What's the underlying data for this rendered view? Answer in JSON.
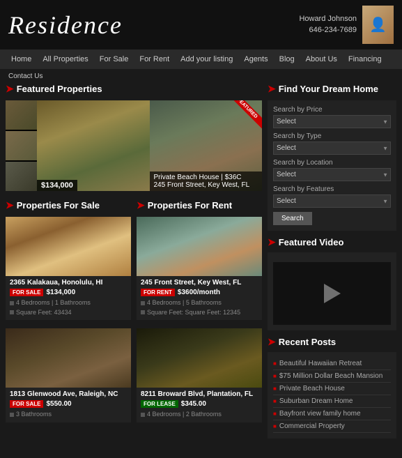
{
  "header": {
    "logo": "Residence",
    "user": {
      "name": "Howard Johnson",
      "phone": "646-234-7689"
    }
  },
  "nav": {
    "items": [
      "Home",
      "All Properties",
      "For Sale",
      "For Rent",
      "Add your listing",
      "Agents",
      "Blog",
      "About Us",
      "Financing"
    ]
  },
  "contact": {
    "label": "Contact Us"
  },
  "featured_properties": {
    "title": "Featured Properties",
    "badge": "FEATURED",
    "slide1": {
      "price": "$134,000"
    },
    "slide2": {
      "caption": "Private Beach House | $36C",
      "address": "245 Front Street, Key West, FL"
    }
  },
  "properties_for_sale": {
    "title": "Properties For Sale",
    "properties": [
      {
        "address": "2365 Kalakaua, Honolulu, HI",
        "tag": "FOR SALE",
        "price": "$134,000",
        "beds": "4 Bedrooms | 1 Bathrooms",
        "sqft": "Square Feet: 43434"
      }
    ]
  },
  "properties_for_rent": {
    "title": "Properties For Rent",
    "properties": [
      {
        "address": "245 Front Street, Key West, FL",
        "tag": "FOR RENT",
        "price": "$3600/month",
        "beds": "4 Bedrooms | 5 Bathrooms",
        "sqft": "Square Feet: Square Feet: 12345"
      }
    ]
  },
  "properties_row2_sale": {
    "properties": [
      {
        "address": "1813 Glenwood Ave, Raleigh, NC",
        "tag": "FOR SALE",
        "price": "$550.00",
        "beds": "3 Bathrooms"
      }
    ]
  },
  "properties_row2_lease": {
    "properties": [
      {
        "address": "8211 Broward Blvd, Plantation, FL",
        "tag": "FOR LEASE",
        "price": "$345.00",
        "beds": "4 Bedrooms | 2 Bathrooms"
      }
    ]
  },
  "find_dream_home": {
    "title": "Find Your Dream Home",
    "price_label": "Search by Price",
    "type_label": "Search by Type",
    "location_label": "Search by Location",
    "features_label": "Search by Features",
    "select_placeholder": "Select",
    "search_button": "Search"
  },
  "featured_video": {
    "title": "Featured Video"
  },
  "recent_posts": {
    "title": "Recent Posts",
    "posts": [
      "Beautiful Hawaiian Retreat",
      "$75 Million Dollar Beach Mansion",
      "Private Beach House",
      "Suburban Dream Home",
      "Bayfront view family home",
      "Commercial Property"
    ]
  }
}
